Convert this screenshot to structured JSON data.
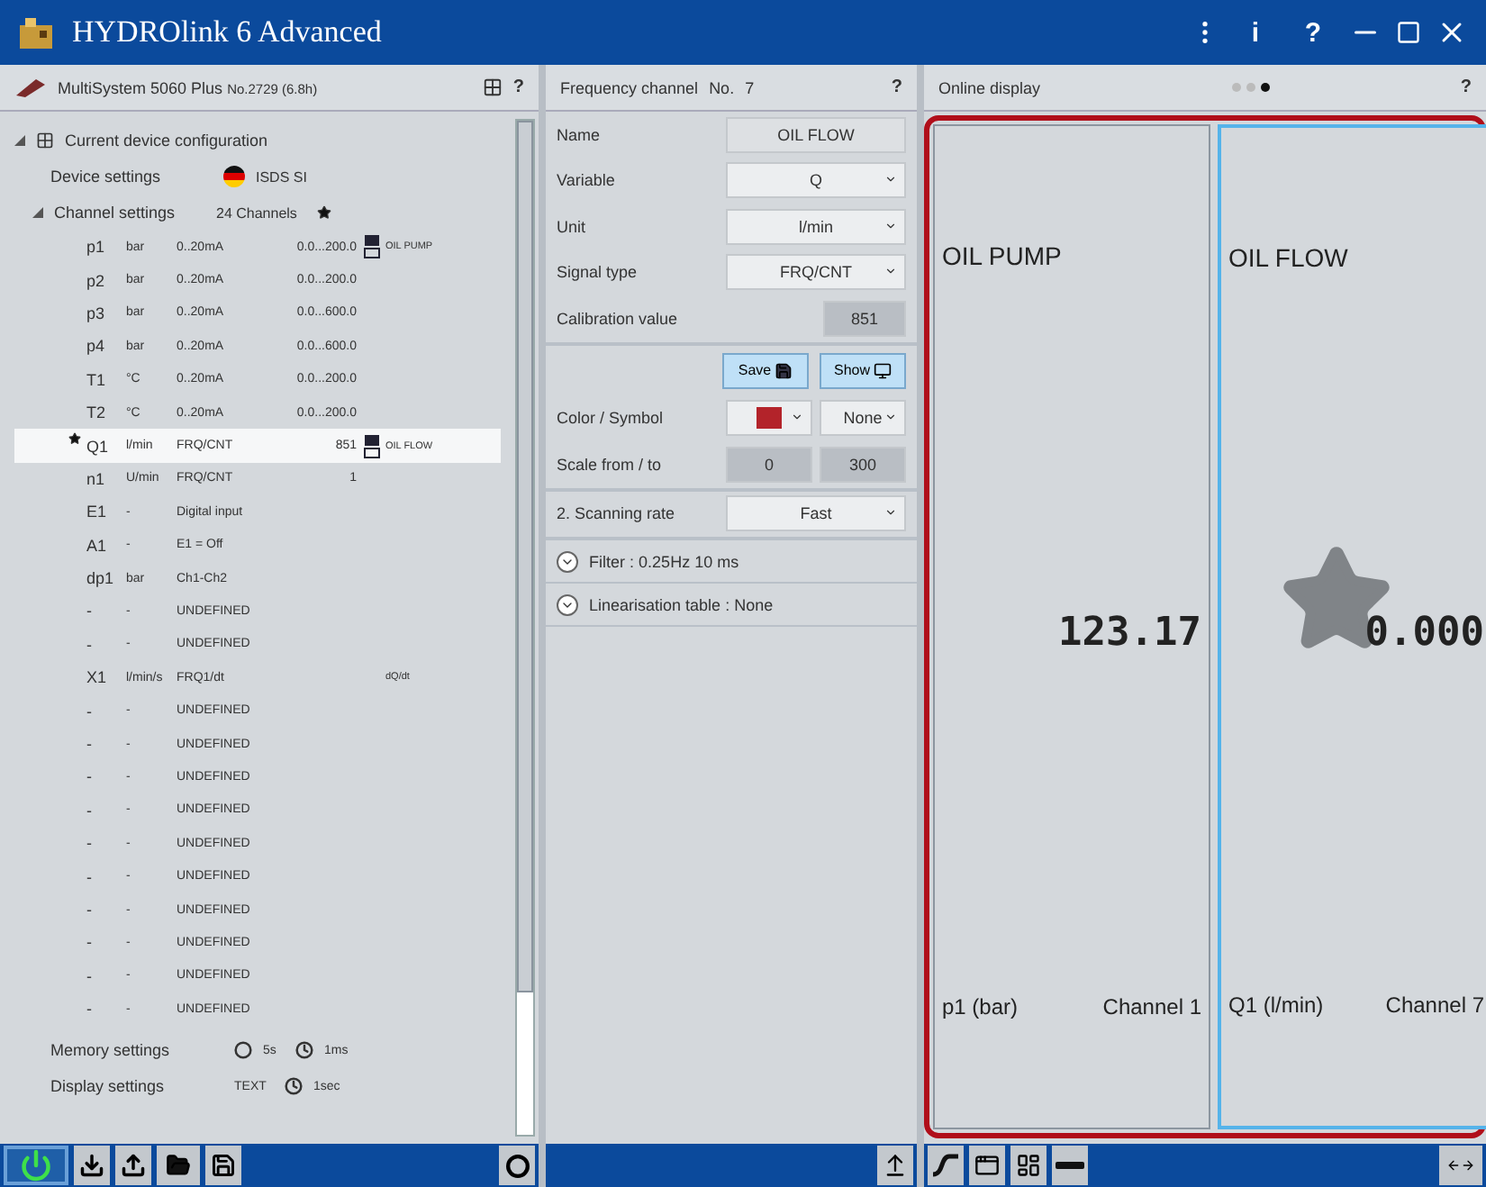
{
  "window": {
    "title": "HYDROlink 6 Advanced",
    "buttons": [
      "i",
      "?"
    ]
  },
  "device_panel": {
    "header": "MultiSystem 5060 Plus",
    "serial": "No.2729 (6.8h)",
    "help": "?",
    "root": {
      "label": "Current device configuration",
      "expanded": true
    },
    "device_settings": {
      "label": "Device settings",
      "value": "ISDS SI"
    },
    "channel_settings": {
      "label": "Channel settings",
      "count": "24 Channels",
      "expanded": true
    },
    "channels": [
      {
        "name": "p1",
        "unit": "bar",
        "signal": "0..20mA",
        "range": "0.0...200.0",
        "saved": true,
        "label": "OIL PUMP",
        "selected": false
      },
      {
        "name": "p2",
        "unit": "bar",
        "signal": "0..20mA",
        "range": "0.0...200.0",
        "saved": false,
        "selected": false
      },
      {
        "name": "p3",
        "unit": "bar",
        "signal": "0..20mA",
        "range": "0.0...600.0",
        "saved": false,
        "selected": false
      },
      {
        "name": "p4",
        "unit": "bar",
        "signal": "0..20mA",
        "range": "0.0...600.0",
        "saved": false,
        "selected": false
      },
      {
        "name": "T1",
        "unit": "°C",
        "signal": "0..20mA",
        "range": "0.0...200.0",
        "saved": false,
        "selected": false
      },
      {
        "name": "T2",
        "unit": "°C",
        "signal": "0..20mA",
        "range": "0.0...200.0",
        "saved": false,
        "selected": false
      },
      {
        "name": "Q1",
        "unit": "l/min",
        "signal": "FRQ/CNT",
        "range": "851",
        "saved": true,
        "label": "OIL FLOW",
        "selected": true
      },
      {
        "name": "n1",
        "unit": "U/min",
        "signal": "FRQ/CNT",
        "range": "1",
        "saved": false,
        "selected": false
      },
      {
        "name": "E1",
        "unit": "-",
        "signal": "Digital input",
        "saved": false,
        "selected": false
      },
      {
        "name": "A1",
        "unit": "-",
        "signal": "E1 = Off",
        "saved": false,
        "selected": false
      },
      {
        "name": "dp1",
        "unit": "bar",
        "signal": "Ch1-Ch2",
        "saved": false,
        "selected": false
      },
      {
        "name": "-",
        "unit": "-",
        "signal": "UNDEFINED",
        "saved": false,
        "selected": false
      },
      {
        "name": "-",
        "unit": "-",
        "signal": "UNDEFINED",
        "saved": false,
        "selected": false
      },
      {
        "name": "X1",
        "unit": "l/min/s",
        "signal": "FRQ1/dt",
        "saved": false,
        "label": "dQ/dt",
        "selected": false
      },
      {
        "name": "-",
        "unit": "-",
        "signal": "UNDEFINED",
        "saved": false,
        "selected": false
      },
      {
        "name": "-",
        "unit": "-",
        "signal": "UNDEFINED",
        "saved": false,
        "selected": false
      },
      {
        "name": "-",
        "unit": "-",
        "signal": "UNDEFINED",
        "saved": false,
        "selected": false
      },
      {
        "name": "-",
        "unit": "-",
        "signal": "UNDEFINED",
        "saved": false,
        "selected": false
      },
      {
        "name": "-",
        "unit": "-",
        "signal": "UNDEFINED",
        "saved": false,
        "selected": false
      },
      {
        "name": "-",
        "unit": "-",
        "signal": "UNDEFINED",
        "saved": false,
        "selected": false
      },
      {
        "name": "-",
        "unit": "-",
        "signal": "UNDEFINED",
        "saved": false,
        "selected": false
      },
      {
        "name": "-",
        "unit": "-",
        "signal": "UNDEFINED",
        "saved": false,
        "selected": false
      },
      {
        "name": "-",
        "unit": "-",
        "signal": "UNDEFINED",
        "saved": false,
        "selected": false
      },
      {
        "name": "-",
        "unit": "-",
        "signal": "UNDEFINED",
        "saved": false,
        "selected": false
      }
    ],
    "memory_settings": {
      "label": "Memory settings",
      "interval": "5s",
      "rate": "1ms"
    },
    "display_settings": {
      "label": "Display settings",
      "mode": "TEXT",
      "rate": "1sec"
    }
  },
  "config_panel": {
    "header": "Frequency channel",
    "number_label": "No.",
    "number": "7",
    "help": "?",
    "fields": [
      {
        "kind": "text",
        "label": "Name",
        "value": "OIL FLOW"
      },
      {
        "kind": "select",
        "label": "Variable",
        "value": "Q"
      },
      {
        "kind": "select",
        "label": "Unit",
        "value": "l/min"
      },
      {
        "kind": "select",
        "label": "Signal type",
        "value": "FRQ/CNT"
      },
      {
        "kind": "readonly",
        "label": "Calibration value",
        "value": "851"
      }
    ],
    "buttons": [
      {
        "kind": "save",
        "label": "Save"
      },
      {
        "kind": "show",
        "label": "Show"
      }
    ],
    "color_symbol": {
      "label": "Color / Symbol",
      "color": "#b3232a",
      "symbol": "None"
    },
    "scale": {
      "label": "Scale from / to",
      "from": "0",
      "to": "300"
    },
    "scanning_rate": {
      "label": "2. Scanning rate",
      "value": "Fast"
    },
    "sections": [
      {
        "label": "Filter",
        "separator": ":",
        "value": "0.25Hz  10 ms",
        "expanded": false
      },
      {
        "label": "Linearisation table",
        "separator": ":",
        "value": "None",
        "expanded": false
      }
    ]
  },
  "online_display": {
    "title": "Online display",
    "help": "?",
    "pages": [
      {
        "selected": false
      },
      {
        "selected": false
      },
      {
        "selected": true
      }
    ],
    "tiles": [
      {
        "title": "OIL PUMP",
        "value": "123.17",
        "variable": "p1 (bar)",
        "channel": "Channel 1",
        "selected": false,
        "starred": false
      },
      {
        "title": "OIL FLOW",
        "value": "0.000",
        "variable": "Q1 (l/min)",
        "channel": "Channel 7",
        "selected": true,
        "starred": true
      }
    ]
  }
}
